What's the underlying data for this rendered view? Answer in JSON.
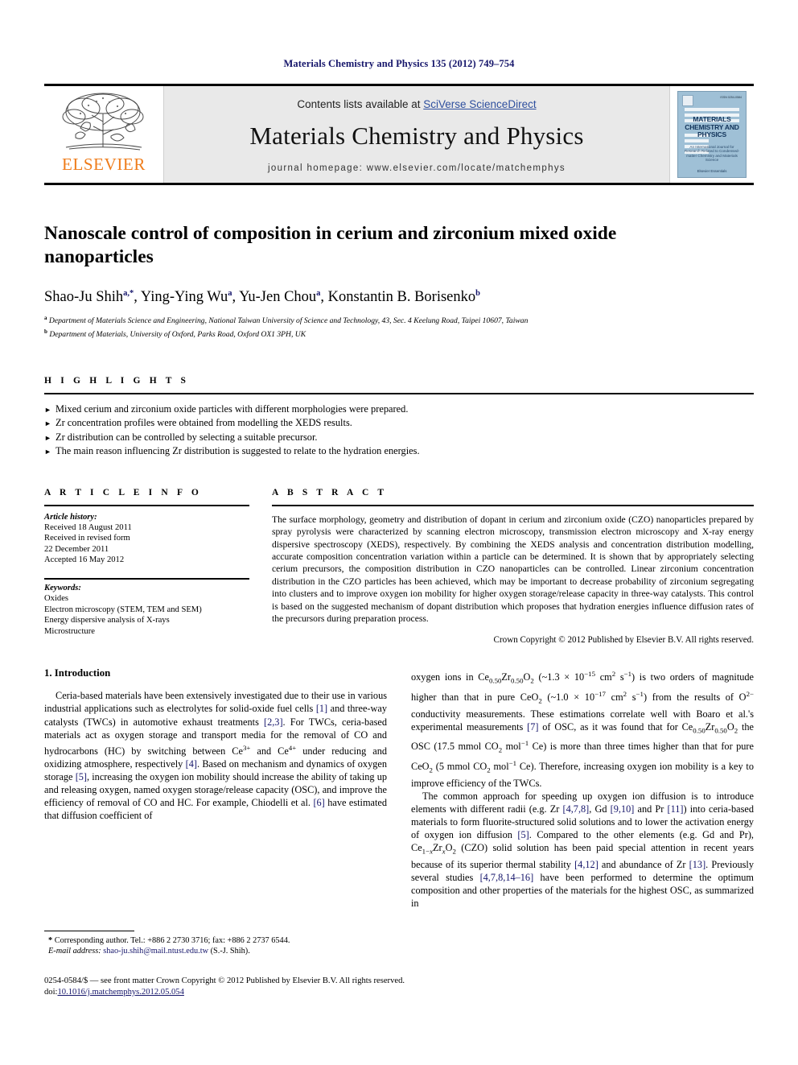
{
  "running_head": "Materials Chemistry and Physics 135 (2012) 749–754",
  "publisher": {
    "wordmark": "ELSEVIER",
    "logo_icon": "elsevier-tree-logo"
  },
  "masthead": {
    "contents_prefix": "Contents lists available at ",
    "contents_link": "SciVerse ScienceDirect",
    "journal_title": "Materials Chemistry and Physics",
    "homepage": "journal homepage: www.elsevier.com/locate/matchemphys"
  },
  "cover": {
    "title_lines": [
      "MATERIALS",
      "CHEMISTRY AND",
      "PHYSICS"
    ],
    "subtitle": "An International Journal for Research Related to Condensed-matter Chemistry and Materials Science",
    "footer": "Elsevier Essentials",
    "issn": "ISSN 0254-0584"
  },
  "article": {
    "title": "Nanoscale control of composition in cerium and zirconium mixed oxide nanoparticles",
    "authors_html": "Shao-Ju Shih<sup>a,*</sup>, Ying-Ying Wu<sup>a</sup>, Yu-Jen Chou<sup>a</sup>, Konstantin B. Borisenko<sup>b</sup>",
    "affiliations": [
      "Department of Materials Science and Engineering, National Taiwan University of Science and Technology, 43, Sec. 4 Keelung Road, Taipei 10607, Taiwan",
      "Department of Materials, University of Oxford, Parks Road, Oxford OX1 3PH, UK"
    ]
  },
  "highlights": {
    "heading": "H I G H L I G H T S",
    "items": [
      "Mixed cerium and zirconium oxide particles with different morphologies were prepared.",
      "Zr concentration profiles were obtained from modelling the XEDS results.",
      "Zr distribution can be controlled by selecting a suitable precursor.",
      "The main reason influencing Zr distribution is suggested to relate to the hydration energies."
    ],
    "bullet_icon": "triangle-right-icon"
  },
  "article_info": {
    "heading": "A R T I C L E   I N F O",
    "history_label": "Article history:",
    "history": [
      "Received 18 August 2011",
      "Received in revised form",
      "22 December 2011",
      "Accepted 16 May 2012"
    ],
    "keywords_label": "Keywords:",
    "keywords": [
      "Oxides",
      "Electron microscopy (STEM, TEM and SEM)",
      "Energy dispersive analysis of X-rays",
      "Microstructure"
    ]
  },
  "abstract": {
    "heading": "A B S T R A C T",
    "text": "The surface morphology, geometry and distribution of dopant in cerium and zirconium oxide (CZO) nanoparticles prepared by spray pyrolysis were characterized by scanning electron microscopy, transmission electron microscopy and X-ray energy dispersive spectroscopy (XEDS), respectively. By combining the XEDS analysis and concentration distribution modelling, accurate composition concentration variation within a particle can be determined. It is shown that by appropriately selecting cerium precursors, the composition distribution in CZO nanoparticles can be controlled. Linear zirconium concentration distribution in the CZO particles has been achieved, which may be important to decrease probability of zirconium segregating into clusters and to improve oxygen ion mobility for higher oxygen storage/release capacity in three-way catalysts. This control is based on the suggested mechanism of dopant distribution which proposes that hydration energies influence diffusion rates of the precursors during preparation process.",
    "copyright": "Crown Copyright © 2012 Published by Elsevier B.V. All rights reserved."
  },
  "introduction": {
    "heading": "1.  Introduction",
    "left_paragraph_1_html": "Ceria-based materials have been extensively investigated due to their use in various industrial applications such as electrolytes for solid-oxide fuel cells <span class=\"cite\">[1]</span> and three-way catalysts (TWCs) in automotive exhaust treatments <span class=\"cite\">[2,3]</span>. For TWCs, ceria-based materials act as oxygen storage and transport media for the removal of CO and hydrocarbons (HC) by switching between Ce<sup class=\"sm\">3+</sup> and Ce<sup class=\"sm\">4+</sup> under reducing and oxidizing atmosphere, respectively <span class=\"cite\">[4]</span>. Based on mechanism and dynamics of oxygen storage <span class=\"cite\">[5]</span>, increasing the oxygen ion mobility should increase the ability of taking up and releasing oxygen, named oxygen storage/release capacity (OSC), and improve the efficiency of removal of CO and HC. For example, Chiodelli et al. <span class=\"cite\">[6]</span> have estimated that diffusion coefficient of",
    "right_paragraph_1_html": "oxygen ions in Ce<sub>0.50</sub>Zr<sub>0.50</sub>O<sub>2</sub> (~1.3 × 10<sup class=\"sm\">−15</sup> cm<sup class=\"sm\">2</sup> s<sup class=\"sm\">−1</sup>) is two orders of magnitude higher than that in pure CeO<sub>2</sub> (~1.0 × 10<sup class=\"sm\">−17</sup> cm<sup class=\"sm\">2</sup> s<sup class=\"sm\">−1</sup>) from the results of O<sup class=\"sm\">2−</sup> conductivity measurements. These estimations correlate well with Boaro et al.'s experimental measurements <span class=\"cite\">[7]</span> of OSC, as it was found that for Ce<sub>0.50</sub>Zr<sub>0.50</sub>O<sub>2</sub> the OSC (17.5 mmol CO<sub>2</sub> mol<sup class=\"sm\">−1</sup> Ce) is more than three times higher than that for pure CeO<sub>2</sub> (5 mmol CO<sub>2</sub> mol<sup class=\"sm\">−1</sup> Ce). Therefore, increasing oxygen ion mobility is a key to improve efficiency of the TWCs.",
    "right_paragraph_2_html": "The common approach for speeding up oxygen ion diffusion is to introduce elements with different radii (e.g. Zr <span class=\"cite\">[4,7,8]</span>, Gd <span class=\"cite\">[9,10]</span> and Pr <span class=\"cite\">[11]</span>) into ceria-based materials to form fluorite-structured solid solutions and to lower the activation energy of oxygen ion diffusion <span class=\"cite\">[5]</span>. Compared to the other elements (e.g. Gd and Pr), Ce<sub>1−<i>x</i></sub>Zr<sub><i>x</i></sub>O<sub>2</sub> (CZO) solid solution has been paid special attention in recent years because of its superior thermal stability <span class=\"cite\">[4,12]</span> and abundance of Zr <span class=\"cite\">[13]</span>. Previously several studies <span class=\"cite\">[4,7,8,14–16]</span> have been performed to determine the optimum composition and other properties of the materials for the highest OSC, as summarized in"
  },
  "footnote": {
    "corresponding_html": "<b>*</b> Corresponding author. Tel.: +886 2 2730 3716; fax: +886 2 2737 6544.",
    "email_html": "<i>E-mail address:</i> <span class=\"fn-mail\">shao-ju.shih@mail.ntust.edu.tw</span> (S.-J. Shih)."
  },
  "page_footer": {
    "issn_line": "0254-0584/$ — see front matter Crown Copyright © 2012 Published by Elsevier B.V. All rights reserved.",
    "doi_label": "doi:",
    "doi_value": "10.1016/j.matchemphys.2012.05.054"
  },
  "colors": {
    "header_blue": "#16166b",
    "link_blue": "#2e4f9e",
    "elsevier_orange": "#ef7c1a",
    "masthead_gray": "#e9e9e9",
    "cover_blue": "#9fc0d6"
  }
}
